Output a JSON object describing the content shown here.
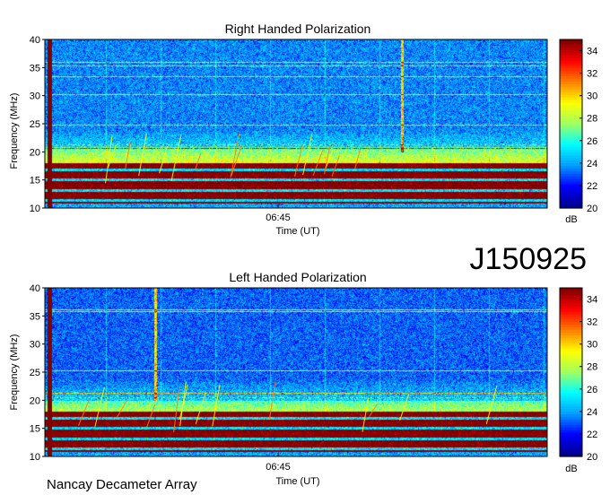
{
  "figure": {
    "date_label": "J150925",
    "observatory": "Nancay Decameter Array"
  },
  "chart_data": [
    {
      "type": "heatmap",
      "title": "Right Handed Polarization",
      "xlabel": "Time (UT)",
      "ylabel": "Frequency (MHz)",
      "x_ticks": [
        "06:45"
      ],
      "y_ticks": [
        10,
        15,
        20,
        25,
        30,
        35,
        40
      ],
      "ylim": [
        10,
        40
      ],
      "colorbar": {
        "label": "dB",
        "ticks": [
          20,
          22,
          24,
          26,
          28,
          30,
          32,
          34
        ],
        "range": [
          20,
          35
        ]
      },
      "colormap": [
        "#00008f",
        "#0000ff",
        "#00a0ff",
        "#00ffff",
        "#a0ff60",
        "#ffff00",
        "#ff8000",
        "#ff0000",
        "#800000"
      ],
      "features": {
        "background_db": 23.5,
        "low_band_saturation_mhz": [
          10,
          18
        ],
        "moderate_band_mhz": [
          18,
          21
        ],
        "persistent_lines_mhz": [
          36,
          35.4,
          33.5,
          30.2,
          24.8,
          21.3,
          20.7
        ],
        "strong_vertical_burst_time_fraction": 0.71,
        "left_edge_burst_time_fraction": 0.005
      }
    },
    {
      "type": "heatmap",
      "title": "Left Handed Polarization",
      "xlabel": "Time (UT)",
      "ylabel": "Frequency (MHz)",
      "x_ticks": [
        "06:45"
      ],
      "y_ticks": [
        10,
        15,
        20,
        25,
        30,
        35,
        40
      ],
      "ylim": [
        10,
        40
      ],
      "colorbar": {
        "label": "dB",
        "ticks": [
          20,
          22,
          24,
          26,
          28,
          30,
          32,
          34
        ],
        "range": [
          20,
          35
        ]
      },
      "colormap": [
        "#00008f",
        "#0000ff",
        "#00a0ff",
        "#00ffff",
        "#a0ff60",
        "#ffff00",
        "#ff8000",
        "#ff0000",
        "#800000"
      ],
      "features": {
        "background_db": 23.0,
        "low_band_saturation_mhz": [
          10,
          18
        ],
        "moderate_band_mhz": [
          18,
          20
        ],
        "persistent_lines_mhz": [
          36.2,
          35.8,
          25.3,
          21.3,
          20.6
        ],
        "strong_vertical_burst_time_fraction": 0.22,
        "left_edge_burst_time_fraction": 0.005
      }
    }
  ]
}
